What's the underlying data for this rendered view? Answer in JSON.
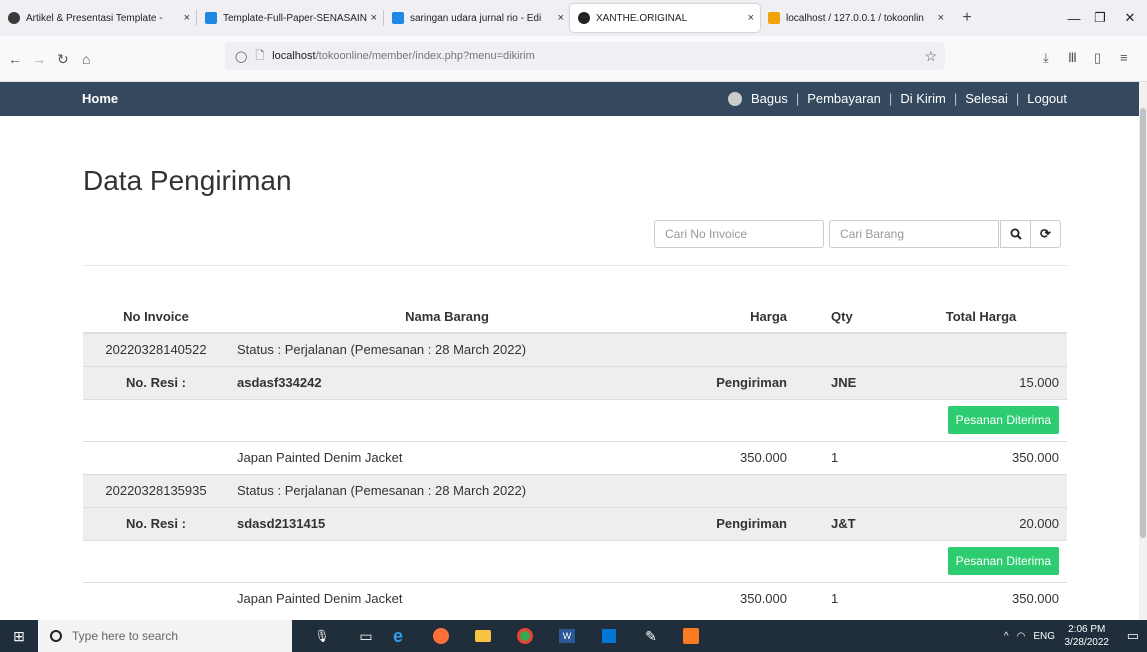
{
  "browser": {
    "tabs": [
      {
        "label": "Artikel & Presentasi Template -",
        "color": "#3b3b3b"
      },
      {
        "label": "Template-Full-Paper-SENASAIN",
        "color": "#1e88e5"
      },
      {
        "label": "saringan udara jurnal rio - Edi",
        "color": "#1e88e5"
      },
      {
        "label": "XANTHE.ORIGINAL",
        "color": "#222222"
      },
      {
        "label": "localhost / 127.0.0.1 / tokoonlin",
        "color": "#f0a30a"
      }
    ],
    "url_host": "localhost",
    "url_path": "/tokoonline/member/index.php?menu=dikirim"
  },
  "header": {
    "brand": "Home",
    "menu": [
      "Bagus",
      "Pembayaran",
      "Di Kirim",
      "Selesai",
      "Logout"
    ],
    "bg_color": "#34495e"
  },
  "page": {
    "title": "Data Pengiriman",
    "search_invoice_placeholder": "Cari No Invoice",
    "search_barang_placeholder": "Cari Barang",
    "search_icon": "search-icon",
    "refresh_icon": "refresh-icon"
  },
  "table": {
    "columns": [
      "No Invoice",
      "Nama Barang",
      "Harga",
      "Qty",
      "Total Harga"
    ],
    "orders": [
      {
        "invoice": "20220328140522",
        "status": "Status : Perjalanan (Pemesanan : 28 March 2022)",
        "resi_label": "No. Resi :",
        "resi": "asdasf334242",
        "shipping_label": "Pengiriman",
        "courier": "JNE",
        "shipping_cost": "15.000",
        "button": "Pesanan Diterima",
        "item": {
          "name": "Japan Painted Denim Jacket",
          "price": "350.000",
          "qty": "1",
          "total": "350.000"
        }
      },
      {
        "invoice": "20220328135935",
        "status": "Status : Perjalanan (Pemesanan : 28 March 2022)",
        "resi_label": "No. Resi :",
        "resi": "sdasd2131415",
        "shipping_label": "Pengiriman",
        "courier": "J&T",
        "shipping_cost": "20.000",
        "button": "Pesanan Diterima",
        "item": {
          "name": "Japan Painted Denim Jacket",
          "price": "350.000",
          "qty": "1",
          "total": "350.000"
        }
      }
    ],
    "button_color": "#2ecc71"
  },
  "taskbar": {
    "search_placeholder": "Type here to search",
    "time": "2:06 PM",
    "date": "3/28/2022"
  }
}
